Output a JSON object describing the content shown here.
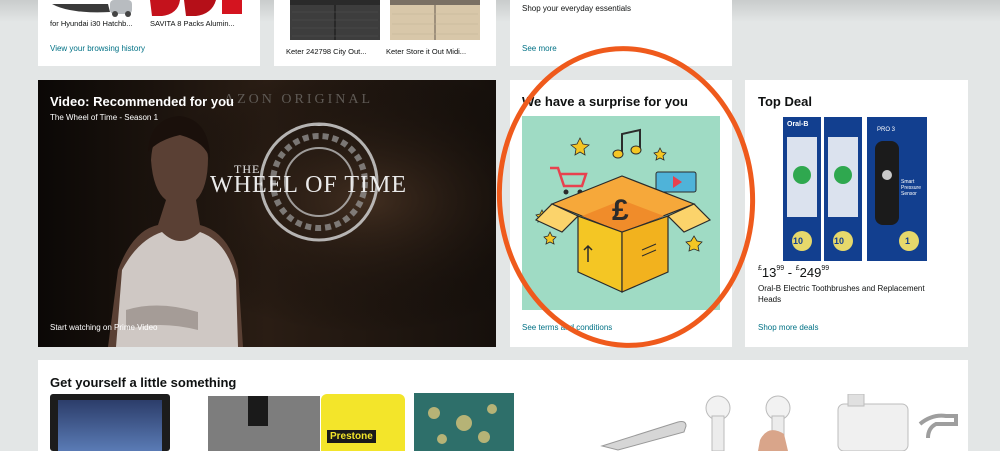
{
  "row1": {
    "card1": {
      "captions": [
        "for Hyundai i30 Hatchb...",
        "SAVITA 8 Packs Alumin..."
      ],
      "link": "View your browsing history"
    },
    "card2": {
      "captions": [
        "Keter 242798 City Out...",
        "Keter Store it Out Midi..."
      ]
    },
    "card3": {
      "subtitle": "Shop your everyday essentials",
      "link": "See more"
    }
  },
  "video": {
    "title": "Video: Recommended for you",
    "subtitle": "The Wheel of Time - Season 1",
    "overlay_top": "AZON ORIGINAL",
    "show_title_left": "THE",
    "show_title": "WHEEL OF TIME",
    "cta": "Start watching on Prime Video"
  },
  "surprise": {
    "title": "We have a surprise for you",
    "currency_symbol": "£",
    "link": "See terms and conditions"
  },
  "topdeal": {
    "title": "Top Deal",
    "price_low_whole": "13",
    "price_low_frac": "99",
    "price_high_whole": "249",
    "price_high_frac": "99",
    "currency": "£",
    "product": "Oral-B Electric Toothbrushes and Replacement Heads",
    "link": "Shop more deals",
    "pack_brand": "Oral-B",
    "pack_count_a": "10",
    "pack_count_b": "10",
    "pack_count_c": "1",
    "pack_c_model": "PRO 3",
    "pack_c_caption": "Smart Pressure Sensor"
  },
  "bottom": {
    "title": "Get yourself a little something",
    "prestone": "Prestone"
  },
  "colors": {
    "page_bg": "#e3e6e6",
    "link": "#007185",
    "annotation": "#ef5a1c",
    "surprise_bg": "#9fdbc4",
    "box_orange": "#f6a83a",
    "oralb_blue": "#123f8f"
  }
}
